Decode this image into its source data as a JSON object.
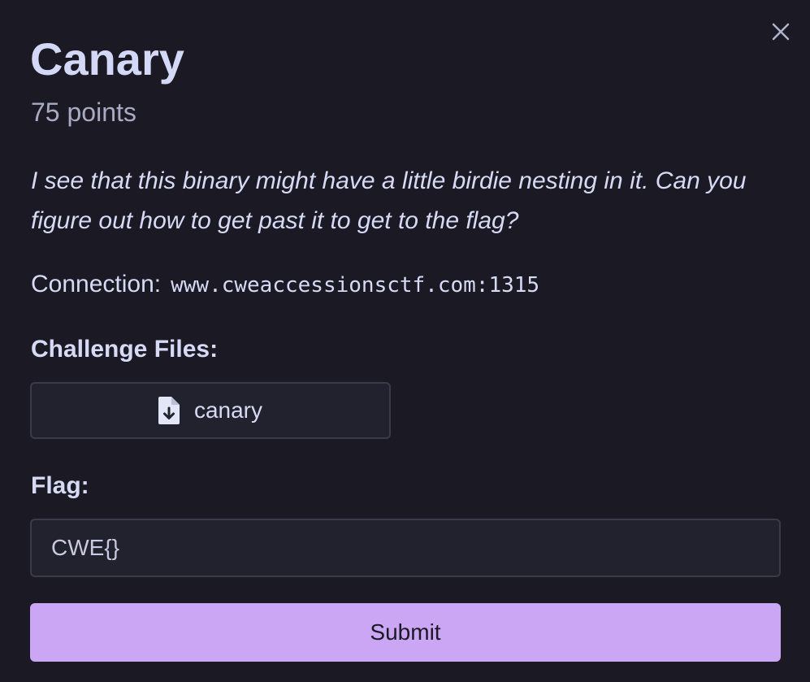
{
  "challenge": {
    "title": "Canary",
    "points": "75 points",
    "description": "I see that this binary might have a little birdie nesting in it. Can you figure out how to get past it to get to the flag?",
    "connection_label": "Connection:",
    "connection_address": "www.cweaccessionsctf.com:1315"
  },
  "files": {
    "label": "Challenge Files:",
    "items": [
      {
        "name": "canary",
        "icon": "file-download-icon"
      }
    ]
  },
  "flag": {
    "label": "Flag:",
    "value": "CWE{}",
    "placeholder": ""
  },
  "actions": {
    "submit_label": "Submit",
    "close_icon": "close-icon"
  },
  "colors": {
    "background": "#1b1a24",
    "text": "#d6daf5",
    "muted": "#a8abc3",
    "accent": "#cba6f5",
    "field_bg": "#22212e",
    "border": "#3a3a4b"
  }
}
